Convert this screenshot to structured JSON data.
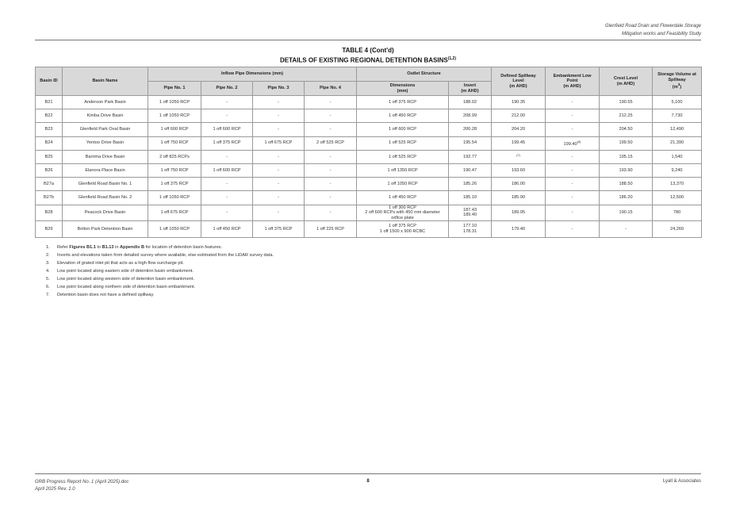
{
  "header": {
    "line1": "Glenfield Road Drain and Flowerdale Storage",
    "line2": "Mitigation works and Feasibility Study"
  },
  "title": {
    "line1": "TABLE 4 (Cont'd)",
    "line2": "DETAILS OF EXISTING REGIONAL DETENTION BASINS",
    "line2_sup": "(1,2)"
  },
  "table": {
    "headers": {
      "basin_id": "Basin ID",
      "basin_name": "Basin Name",
      "inflow": "Inflow Pipe Dimensions (mm)",
      "pipe1": "Pipe No. 1",
      "pipe2": "Pipe No. 2",
      "pipe3": "Pipe No. 3",
      "pipe4": "Pipe No. 4",
      "outlet": "Outlet Structure",
      "dim_1": "Dimensions",
      "dim_2": "(mm)",
      "inv_1": "Invert",
      "inv_2": "(m AHD)",
      "spill_1": "Defined Spillway",
      "spill_2": "Level",
      "spill_3": "(m AHD)",
      "emb_1": "Embankment Low",
      "emb_2": "Point",
      "emb_3": "(m AHD)",
      "crest_1": "Crest Level",
      "crest_2": "(m AHD)",
      "stor_1": "Storage Volume at",
      "stor_2": "Spillway",
      "stor_3": "(m",
      "stor_sup": "3",
      "stor_4": ")"
    },
    "rows": [
      {
        "id": "B21",
        "name": "Anderson Park Basin",
        "p1": "1 off 1050 RCP",
        "p2": "-",
        "p3": "-",
        "p4": "-",
        "dim": "1 off 375 RCP",
        "dim2": "",
        "dim3": "",
        "inv": "188.02",
        "inv2": "",
        "spill": "190.35",
        "spill_sup": "",
        "emb": "-",
        "emb_sup": "",
        "crest": "190.55",
        "stor": "5,100"
      },
      {
        "id": "B22",
        "name": "Kimba Drive Basin",
        "p1": "1 off 1050 RCP",
        "p2": "-",
        "p3": "-",
        "p4": "-",
        "dim": "1 off 450 RCP",
        "dim2": "",
        "dim3": "",
        "inv": "208.99",
        "inv2": "",
        "spill": "212.00",
        "spill_sup": "",
        "emb": "-",
        "emb_sup": "",
        "crest": "212.25",
        "stor": "7,730"
      },
      {
        "id": "B23",
        "name": "Glenfield Park Oval Basin",
        "p1": "1 off 600 RCP",
        "p2": "1 off 600 RCP",
        "p3": "-",
        "p4": "-",
        "dim": "1 off 600 RCP",
        "dim2": "",
        "dim3": "",
        "inv": "200.28",
        "inv2": "",
        "spill": "204.20",
        "spill_sup": "",
        "emb": "-",
        "emb_sup": "",
        "crest": "204.50",
        "stor": "12,490"
      },
      {
        "id": "B24",
        "name": "Yentoo Drive Basin",
        "p1": "1 off 750 RCP",
        "p2": "1 off 375 RCP",
        "p3": "1 off 675 RCP",
        "p4": "2 off 525 RCP",
        "dim": "1 off 525 RCP",
        "dim2": "",
        "dim3": "",
        "inv": "195.54",
        "inv2": "",
        "spill": "199.45",
        "spill_sup": "",
        "emb": "199.40",
        "emb_sup": "(6)",
        "crest": "199.50",
        "stor": "21,390"
      },
      {
        "id": "B25",
        "name": "Barrima Drive Basin",
        "p1": "2 off 825 RCPs",
        "p2": "-",
        "p3": "-",
        "p4": "-",
        "dim": "1 off 525 RCP",
        "dim2": "",
        "dim3": "",
        "inv": "192.77",
        "inv2": "",
        "spill": "",
        "spill_sup": "(7)",
        "emb": "-",
        "emb_sup": "",
        "crest": "195.15",
        "stor": "1,540"
      },
      {
        "id": "B26",
        "name": "Elanora Place Basin",
        "p1": "1 off 750 RCP",
        "p2": "1 off 600 RCP",
        "p3": "-",
        "p4": "-",
        "dim": "1 off 1350 RCP",
        "dim2": "",
        "dim3": "",
        "inv": "190.47",
        "inv2": "",
        "spill": "193.60",
        "spill_sup": "",
        "emb": "-",
        "emb_sup": "",
        "crest": "193.90",
        "stor": "9,240"
      },
      {
        "id": "B27a",
        "name": "Glenfield Road Basin No. 1",
        "p1": "1 off 375 RCP",
        "p2": "-",
        "p3": "-",
        "p4": "-",
        "dim": "1 off 1050 RCP",
        "dim2": "",
        "dim3": "",
        "inv": "185.26",
        "inv2": "",
        "spill": "186.00",
        "spill_sup": "",
        "emb": "-",
        "emb_sup": "",
        "crest": "188.50",
        "stor": "13,370"
      },
      {
        "id": "B27b",
        "name": "Glenfield Road Basin No. 2",
        "p1": "1 off 1050 RCP",
        "p2": "-",
        "p3": "-",
        "p4": "-",
        "dim": "1 off 450 RCP",
        "dim2": "",
        "dim3": "",
        "inv": "185.10",
        "inv2": "",
        "spill": "185.90",
        "spill_sup": "",
        "emb": "-",
        "emb_sup": "",
        "crest": "186.20",
        "stor": "12,500"
      },
      {
        "id": "B28",
        "name": "Peacock Drive Basin",
        "p1": "1 off 675 RCP",
        "p2": "-",
        "p3": "-",
        "p4": "-",
        "dim": "1 off 300 RCP",
        "dim2": "2 off 600 RCPs with 450 mm diameter",
        "dim3": "orifice plate",
        "inv": "187.43",
        "inv2": "189.40",
        "spill": "189.95",
        "spill_sup": "",
        "emb": "-",
        "emb_sup": "",
        "crest": "190.15",
        "stor": "780"
      },
      {
        "id": "B29",
        "name": "Bolton Park Detention Basin",
        "p1": "1 off 1050 RCP",
        "p2": "1 off 450 RCP",
        "p3": "1 off 375 RCP",
        "p4": "1 off 225 RCP",
        "dim": "1 off 375 RCP",
        "dim2": "1 off 1500 x 900 RCBC",
        "dim3": "",
        "inv": "177.10",
        "inv2": "178.31",
        "spill": "179.40",
        "spill_sup": "",
        "emb": "-",
        "emb_sup": "",
        "crest": "-",
        "stor": "24,260"
      }
    ]
  },
  "notes": [
    {
      "num": "1.",
      "pre": "Refer ",
      "b1": "Figures B1.1",
      "mid1": " to ",
      "b2": "B1.13",
      "mid2": " in ",
      "b3": "Appendix B",
      "post": " for location of detention basin features."
    },
    {
      "num": "2.",
      "pre": "Inverts and elevations taken from detailed survey where available, else estimated from the LiDAR survey data.",
      "b1": "",
      "mid1": "",
      "b2": "",
      "mid2": "",
      "b3": "",
      "post": ""
    },
    {
      "num": "3.",
      "pre": "Elevation of grated inlet pit that acts as a high flow surcharge pit.",
      "b1": "",
      "mid1": "",
      "b2": "",
      "mid2": "",
      "b3": "",
      "post": ""
    },
    {
      "num": "4.",
      "pre": "Low point located along eastern side of detention basin embankment.",
      "b1": "",
      "mid1": "",
      "b2": "",
      "mid2": "",
      "b3": "",
      "post": ""
    },
    {
      "num": "5.",
      "pre": "Low point located along western side of detention basin embankment.",
      "b1": "",
      "mid1": "",
      "b2": "",
      "mid2": "",
      "b3": "",
      "post": ""
    },
    {
      "num": "6.",
      "pre": "Low point located along northern side of detention basin embankment.",
      "b1": "",
      "mid1": "",
      "b2": "",
      "mid2": "",
      "b3": "",
      "post": ""
    },
    {
      "num": "7.",
      "pre": "Detention basin does not have a defined spillway.",
      "b1": "",
      "mid1": "",
      "b2": "",
      "mid2": "",
      "b3": "",
      "post": ""
    }
  ],
  "footer": {
    "left1": "GRB Progress Report No. 1 (April 2025).doc",
    "left2": "April 2025  Rev. 1.0",
    "page": "8",
    "right": "Lyall & Associates"
  }
}
